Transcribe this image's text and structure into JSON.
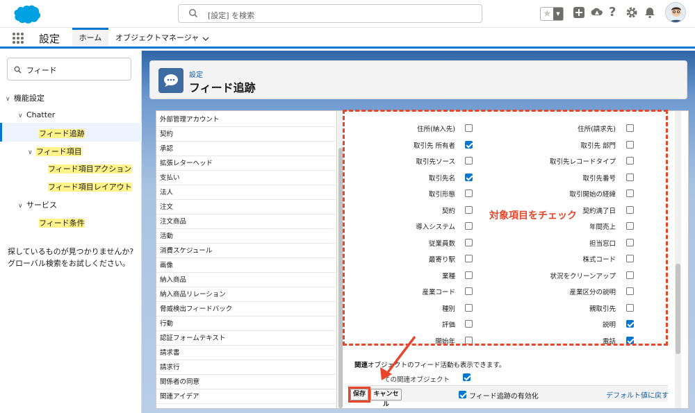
{
  "header": {
    "search_placeholder": "[設定] を検索",
    "icons": [
      "salesforce-cloud-logo",
      "search-icon",
      "favorites-star-icon",
      "add-icon",
      "trailhead-icon",
      "help-icon",
      "gear-icon",
      "bell-icon",
      "avatar"
    ]
  },
  "nav": {
    "app_name": "設定",
    "tabs": [
      {
        "label": "ホーム"
      },
      {
        "label": "オブジェクトマネージャ"
      }
    ]
  },
  "sidebar": {
    "quick_find_value": "フィード",
    "tree": [
      {
        "label": "機能設定"
      },
      {
        "label": "Chatter"
      },
      {
        "label": "フィード追跡"
      },
      {
        "label": "フィード項目"
      },
      {
        "label": "フィード項目アクション"
      },
      {
        "label": "フィード項目レイアウト"
      },
      {
        "label": "サービス"
      },
      {
        "label": "フィード条件"
      }
    ],
    "help_text_1": "探しているものが見つかりませんか?",
    "help_text_2": "グローバル検索をお試しください。"
  },
  "page_header": {
    "subtitle": "設定",
    "title": "フィード追跡"
  },
  "objects": [
    "外部管理アカウント",
    "契約",
    "承認",
    "拡張レターヘッド",
    "支払い",
    "法人",
    "注文",
    "注文商品",
    "活動",
    "消費スケジュール",
    "画像",
    "納入商品",
    "納入商品リレーション",
    "脅威検出フィードバック",
    "行動",
    "認証フォームテキスト",
    "請求書",
    "請求行",
    "関係者の同意",
    "関連アイデア"
  ],
  "fields": [
    {
      "left": "住所(納入先)",
      "left_checked": false,
      "right": "住所(請求先)",
      "right_checked": false
    },
    {
      "left": "取引先 所有者",
      "left_checked": true,
      "right": "取引先 部門",
      "right_checked": false
    },
    {
      "left": "取引先ソース",
      "left_checked": false,
      "right": "取引先レコードタイプ",
      "right_checked": false
    },
    {
      "left": "取引先名",
      "left_checked": true,
      "right": "取引先番号",
      "right_checked": false
    },
    {
      "left": "取引形態",
      "left_checked": false,
      "right": "取引開始の経緯",
      "right_checked": false
    },
    {
      "left": "契約",
      "left_checked": false,
      "right": "契約満了日",
      "right_checked": false
    },
    {
      "left": "導入システム",
      "left_checked": false,
      "right": "年間売上",
      "right_checked": false
    },
    {
      "left": "従業員数",
      "left_checked": false,
      "right": "担当窓口",
      "right_checked": false
    },
    {
      "left": "最寄り駅",
      "left_checked": false,
      "right": "株式コード",
      "right_checked": false
    },
    {
      "left": "業種",
      "left_checked": false,
      "right": "状況をクリーンアップ",
      "right_checked": false
    },
    {
      "left": "産業コード",
      "left_checked": false,
      "right": "産業区分の説明",
      "right_checked": false
    },
    {
      "left": "種別",
      "left_checked": false,
      "right": "親取引先",
      "right_checked": false
    },
    {
      "left": "評価",
      "left_checked": false,
      "right": "説明",
      "right_checked": true
    },
    {
      "left": "開始年",
      "left_checked": false,
      "right": "電話",
      "right_checked": true
    }
  ],
  "annotation": "対象項目をチェック",
  "related": {
    "text_bold": "関連",
    "text_rest": "オブジェクトのフィード活動も表示できます。",
    "all_related_label": "ての関連オブジェクト",
    "all_related_checked": true
  },
  "buttons": {
    "save": "保存",
    "cancel": "キャンセル",
    "enable_label": "フィード追跡の有効化",
    "enable_checked": true,
    "default_link": "デフォルト値に戻す"
  },
  "colors": {
    "brand": "#0176d3",
    "highlight": "#fff38a",
    "annotation": "#e8462a"
  }
}
